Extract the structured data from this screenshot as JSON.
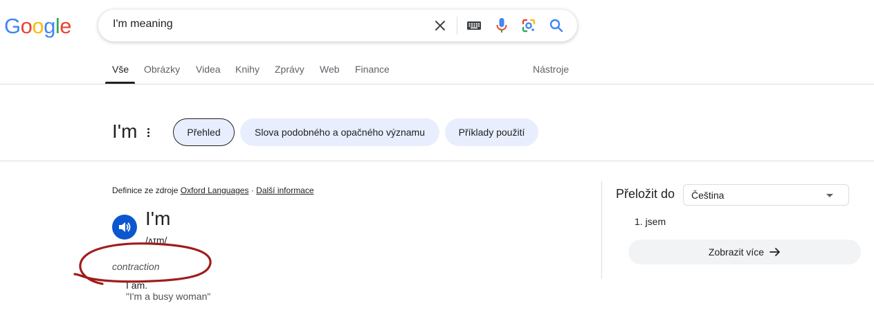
{
  "logo": {
    "letters": [
      "G",
      "o",
      "o",
      "g",
      "l",
      "e"
    ],
    "colors": [
      "#4285f4",
      "#ea4335",
      "#fbbc05",
      "#4285f4",
      "#34a853",
      "#ea4335"
    ]
  },
  "search": {
    "query": "I'm meaning"
  },
  "tabs": [
    {
      "label": "Vše",
      "active": true
    },
    {
      "label": "Obrázky"
    },
    {
      "label": "Videa"
    },
    {
      "label": "Knihy"
    },
    {
      "label": "Zprávy"
    },
    {
      "label": "Web"
    },
    {
      "label": "Finance"
    }
  ],
  "tools_label": "Nástroje",
  "dictionary": {
    "headword": "I'm",
    "chips": [
      "Přehled",
      "Slova podobného a opačného významu",
      "Příklady použití"
    ],
    "source_prefix": "Definice ze zdroje",
    "source_name": "Oxford Languages",
    "separator": "·",
    "more_info": "Další informace",
    "word": "I'm",
    "phonetic": "/ʌɪm/",
    "part_of_speech": "contraction",
    "definition": "I am.",
    "example": "\"I'm a busy woman\""
  },
  "translate": {
    "label": "Přeložit do",
    "language": "Čeština",
    "item": "1. jsem",
    "more_button": "Zobrazit více"
  },
  "colors": {
    "accent_blue": "#0b57d0",
    "chip_bg": "#e8eefd",
    "annotation_red": "#a01c1c"
  },
  "icons": [
    "clear-icon",
    "keyboard-icon",
    "microphone-icon",
    "lens-icon",
    "search-icon",
    "speaker-icon",
    "arrow-right-icon",
    "kebab-icon",
    "dropdown-caret-icon"
  ]
}
